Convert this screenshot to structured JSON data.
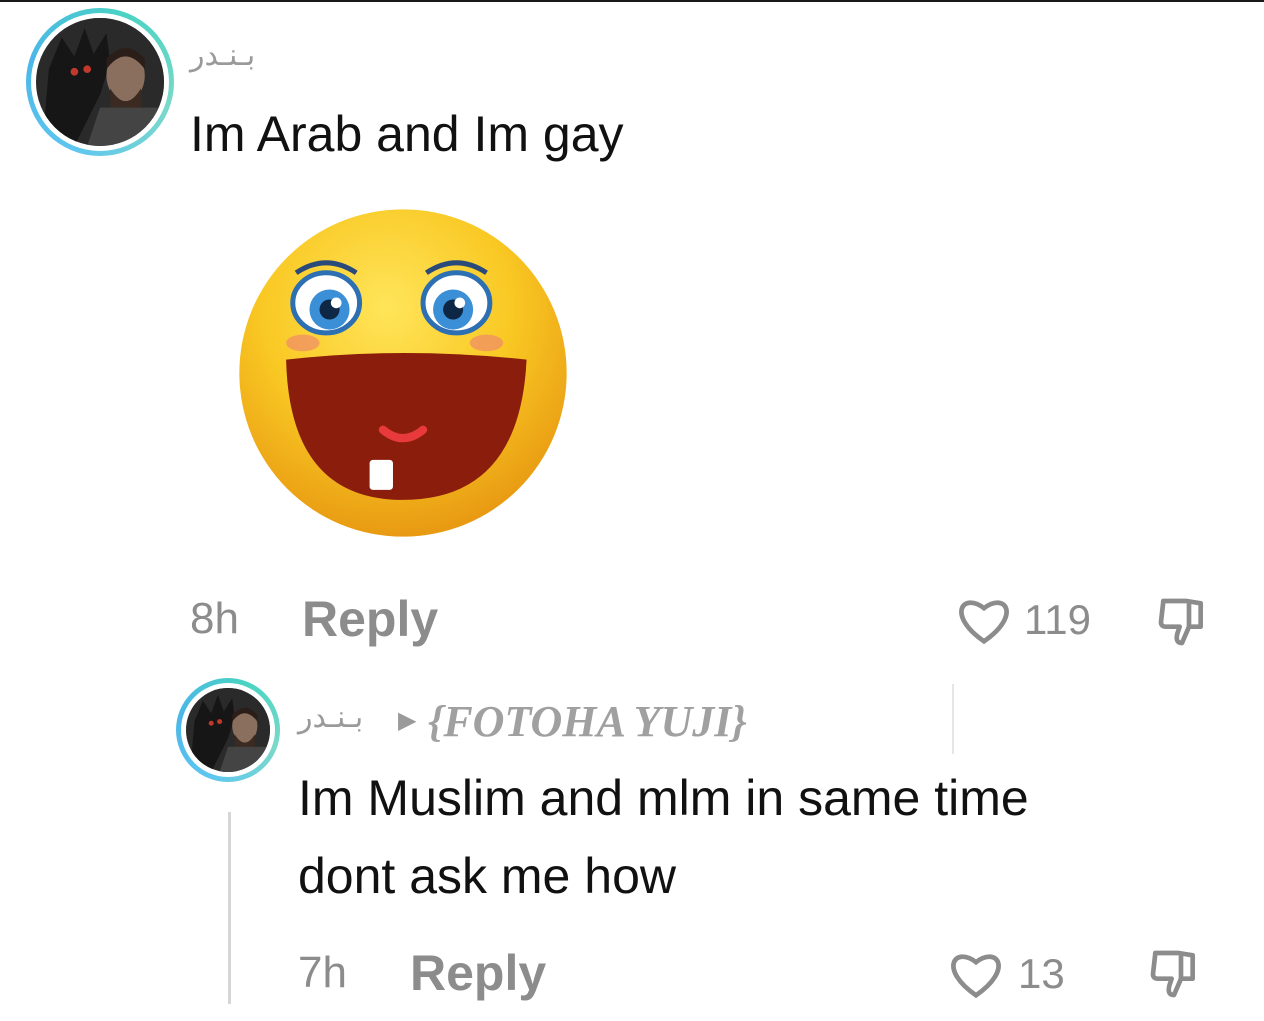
{
  "comment": {
    "username": "بـنـدر",
    "text": "Im Arab and Im gay",
    "time": "8h",
    "reply_label": "Reply",
    "likes": "119",
    "sticker": "laughing-emoji-sticker"
  },
  "reply_comment": {
    "username": "بـنـدر",
    "mention": "{FOTOHA YUJI}",
    "text_line1": "Im Muslim and mlm in same time",
    "text_line2": "dont ask me how",
    "time": "7h",
    "reply_label": "Reply",
    "likes": "13"
  },
  "colors": {
    "avatar_ring": "#4bb7e8",
    "meta_gray": "#8c8c8c"
  }
}
